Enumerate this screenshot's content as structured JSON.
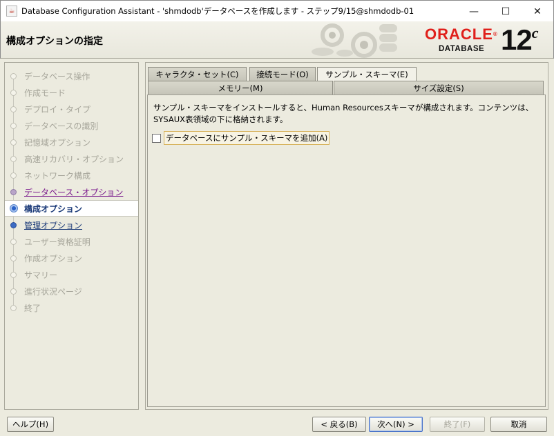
{
  "window": {
    "icon": "java-app-icon",
    "title": "Database Configuration Assistant - 'shmdodb'データベースを作成します - ステップ9/15@shmdodb-01",
    "minimize_glyph": "—",
    "maximize_glyph": "☐",
    "close_glyph": "✕"
  },
  "header": {
    "page_title": "構成オプションの指定",
    "logo_text": "ORACLE",
    "logo_sub": "DATABASE",
    "version_number": "12",
    "version_suffix": "c"
  },
  "steps": [
    {
      "label": "データベース操作",
      "state": "done"
    },
    {
      "label": "作成モード",
      "state": "done"
    },
    {
      "label": "デプロイ・タイプ",
      "state": "done"
    },
    {
      "label": "データベースの識別",
      "state": "done"
    },
    {
      "label": "記憶域オプション",
      "state": "done"
    },
    {
      "label": "高速リカバリ・オプション",
      "state": "done"
    },
    {
      "label": "ネットワーク構成",
      "state": "done"
    },
    {
      "label": "データベース・オプション",
      "state": "visited"
    },
    {
      "label": "構成オプション",
      "state": "current"
    },
    {
      "label": "管理オプション",
      "state": "next"
    },
    {
      "label": "ユーザー資格証明",
      "state": "pending"
    },
    {
      "label": "作成オプション",
      "state": "pending"
    },
    {
      "label": "サマリー",
      "state": "pending"
    },
    {
      "label": "進行状況ページ",
      "state": "pending"
    },
    {
      "label": "終了",
      "state": "pending"
    }
  ],
  "tabs": {
    "row1": [
      {
        "label": "キャラクタ・セット(C)"
      },
      {
        "label": "接続モード(O)"
      },
      {
        "label": "サンプル・スキーマ(E)",
        "selected": true
      }
    ],
    "row2": [
      {
        "label": "メモリー(M)"
      },
      {
        "label": "サイズ設定(S)"
      }
    ]
  },
  "content": {
    "description": "サンプル・スキーマをインストールすると、Human Resourcesスキーマが構成されます。コンテンツは、SYSAUX表領域の下に格納されます。",
    "checkbox_label": "データベースにサンプル・スキーマを追加(A)",
    "checkbox_checked": false
  },
  "buttons": {
    "help": "ヘルプ(H)",
    "back": "< 戻る(B)",
    "next": "次へ(N) >",
    "finish": "終了(F)",
    "cancel": "取消"
  }
}
